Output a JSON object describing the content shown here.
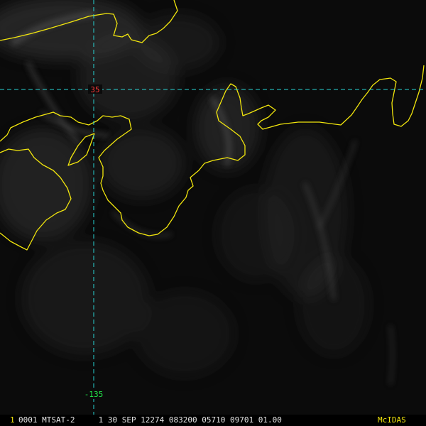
{
  "map": {
    "latitude_label": "35",
    "longitude_label": "-135",
    "colors": {
      "gridline": "#27d4d4",
      "latitude_label": "#ff3b3b",
      "longitude_label": "#21e84a",
      "coastline": "#f2e60d",
      "background": "#000000"
    }
  },
  "status": {
    "frame_number": "1",
    "frame_info": "0001 MTSAT-2     1 30 SEP 12274 083200 05710 09701 01.00",
    "brand": "McIDAS"
  }
}
